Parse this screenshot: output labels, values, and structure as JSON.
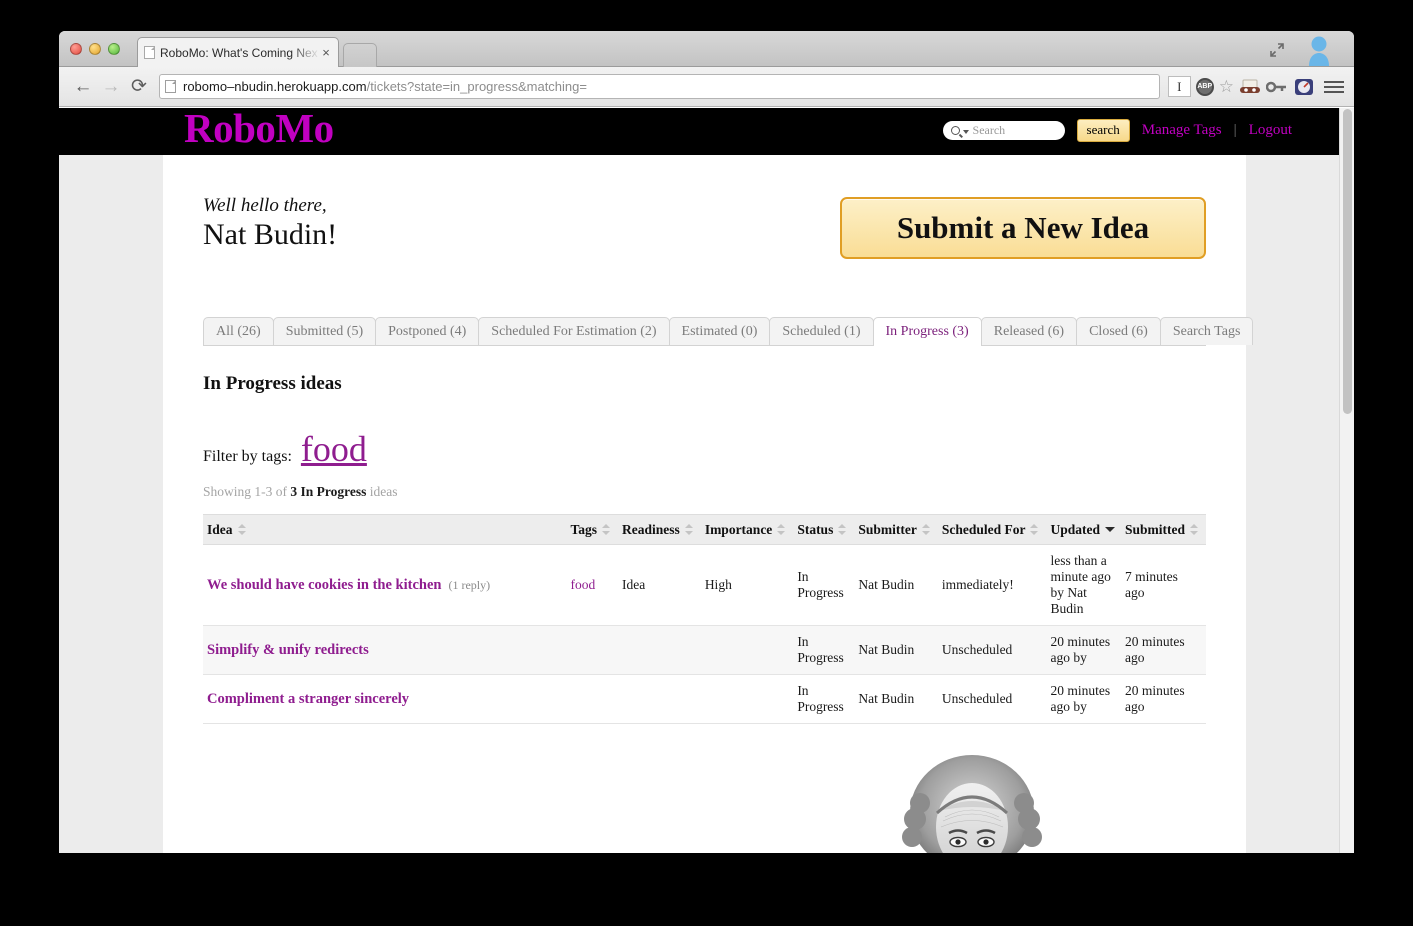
{
  "browser": {
    "tab_title": "RoboMo: What's Coming Nex",
    "tab_close": "×",
    "back_icon": "←",
    "forward_icon": "→",
    "reload_icon": "⟳",
    "url_host": "robomo–nbudin.herokuapp.com",
    "url_path": "/tickets?state=in_progress&matching=",
    "reader_chip": "I",
    "adblock_chip": "ABP",
    "bookmark_icon": "☆",
    "expand_icon": "⤡",
    "menu_icon": "hamburger-menu"
  },
  "header": {
    "logo": "RoboMo",
    "search_placeholder": "Search",
    "search_value": "",
    "search_button": "search",
    "manage_tags": "Manage Tags",
    "separator": "|",
    "logout": "Logout",
    "accent_color": "#c100c1"
  },
  "greeting": {
    "line1": "Well hello there,",
    "line2": "Nat Budin!"
  },
  "submit_button": "Submit a New Idea",
  "tabs": [
    {
      "label": "All (26)",
      "active": false
    },
    {
      "label": "Submitted (5)",
      "active": false
    },
    {
      "label": "Postponed (4)",
      "active": false
    },
    {
      "label": "Scheduled For Estimation (2)",
      "active": false
    },
    {
      "label": "Estimated (0)",
      "active": false
    },
    {
      "label": "Scheduled (1)",
      "active": false
    },
    {
      "label": "In Progress (3)",
      "active": true
    },
    {
      "label": "Released (6)",
      "active": false
    },
    {
      "label": "Closed (6)",
      "active": false
    },
    {
      "label": "Search Tags",
      "active": false
    }
  ],
  "section_title": "In Progress ideas",
  "filter": {
    "label": "Filter by tags:",
    "tag": "food"
  },
  "showing": {
    "prefix": "Showing 1-3 of ",
    "count": "3 In Progress",
    "suffix": " ideas"
  },
  "table": {
    "columns": [
      {
        "label": "Idea",
        "sort": "both"
      },
      {
        "label": "Tags",
        "sort": "both"
      },
      {
        "label": "Readiness",
        "sort": "both"
      },
      {
        "label": "Importance",
        "sort": "both"
      },
      {
        "label": "Status",
        "sort": "both"
      },
      {
        "label": "Submitter",
        "sort": "both"
      },
      {
        "label": "Scheduled For",
        "sort": "both"
      },
      {
        "label": "Updated",
        "sort": "desc"
      },
      {
        "label": "Submitted",
        "sort": "both"
      }
    ],
    "rows": [
      {
        "idea": "We should have cookies in the kitchen",
        "replies": "(1 reply)",
        "tags": "food",
        "readiness": "Idea",
        "importance": "High",
        "status": "In Progress",
        "submitter": "Nat Budin",
        "scheduled_for": "immediately!",
        "updated": "less than a minute ago by Nat Budin",
        "submitted": "7 minutes ago"
      },
      {
        "idea": "Simplify & unify redirects",
        "replies": "",
        "tags": "",
        "readiness": "",
        "importance": "",
        "status": "In Progress",
        "submitter": "Nat Budin",
        "scheduled_for": "Unscheduled",
        "updated": "20 minutes ago by",
        "submitted": "20 minutes ago"
      },
      {
        "idea": "Compliment a stranger sincerely",
        "replies": "",
        "tags": "",
        "readiness": "",
        "importance": "",
        "status": "In Progress",
        "submitter": "Nat Budin",
        "scheduled_for": "Unscheduled",
        "updated": "20 minutes ago by",
        "submitted": "20 minutes ago"
      }
    ]
  }
}
